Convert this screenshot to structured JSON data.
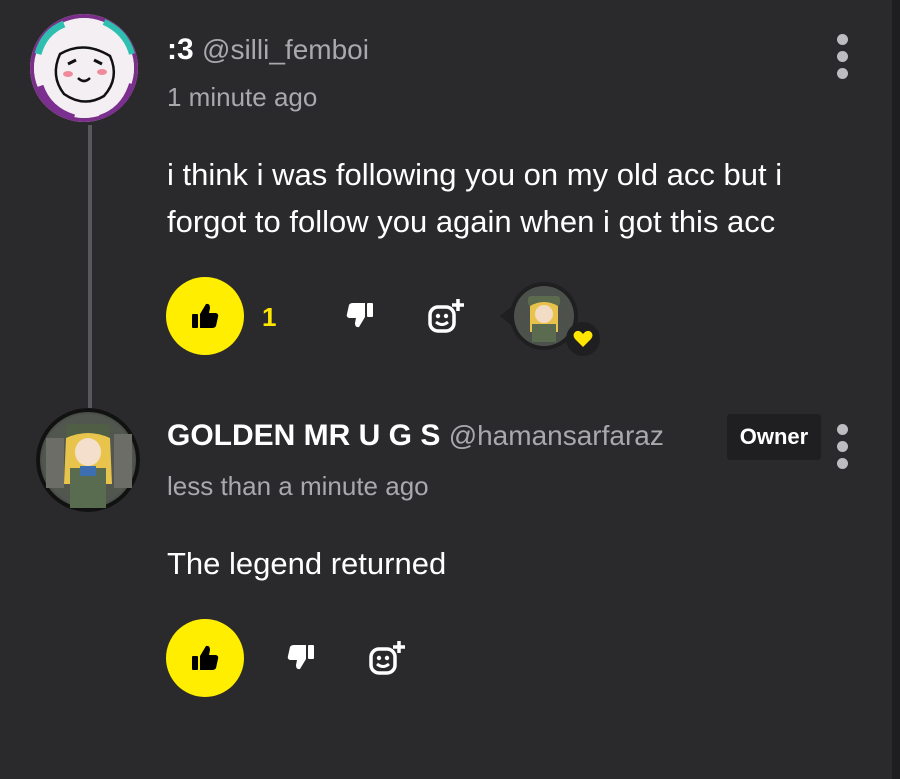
{
  "comment": {
    "author": {
      "display_name": ":3",
      "handle": "@silli_femboi",
      "avatar_icon": "doodle-face-avatar"
    },
    "time": "1 minute ago",
    "text_lines": [
      "i think i was following you on my old acc but i",
      "forgot to follow you again when i got this acc"
    ],
    "likes": "1",
    "creator_heart": {
      "avatar_icon": "creator-avatar",
      "heart_icon": "heart-icon",
      "heart_color": "#ffe600"
    }
  },
  "reply": {
    "author": {
      "display_name": "GOLDEN MR U G S",
      "handle": "@hamansarfaraz",
      "avatar_icon": "anime-character-avatar",
      "badge": "Owner"
    },
    "time": "less than a minute ago",
    "text": "The legend returned"
  },
  "colors": {
    "background": "#2a292c",
    "accent_yellow": "#ffee00",
    "muted_text": "#a9a8ad"
  }
}
